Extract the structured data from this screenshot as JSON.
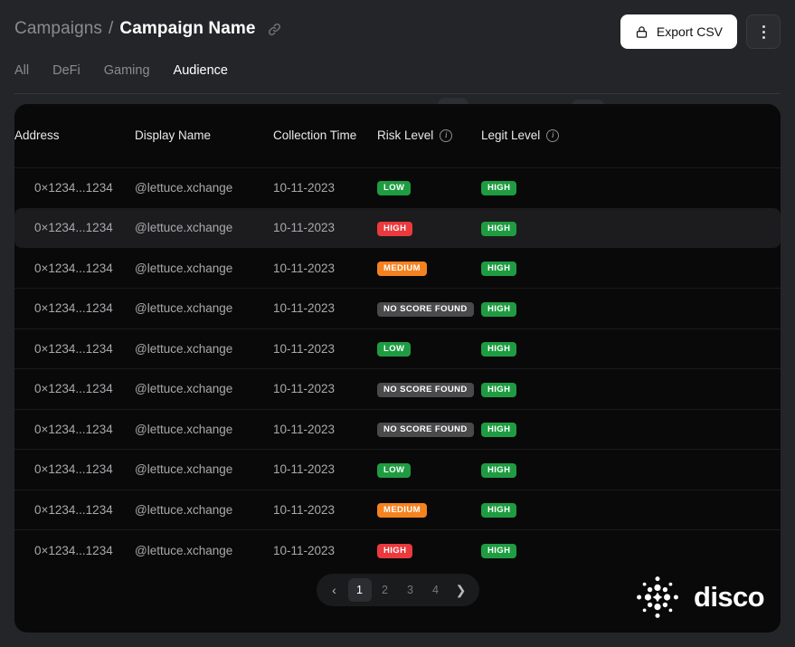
{
  "header": {
    "breadcrumb_root": "Campaigns",
    "breadcrumb_separator": "/",
    "breadcrumb_current": "Campaign Name",
    "link_icon": "chain-link-icon",
    "export_label": "Export CSV",
    "export_icon": "lock-icon",
    "menu_icon": "kebab-menu-icon"
  },
  "tabs": [
    {
      "label": "All",
      "active": false
    },
    {
      "label": "DeFi",
      "active": false
    },
    {
      "label": "Gaming",
      "active": false
    },
    {
      "label": "Audience",
      "active": true
    }
  ],
  "table": {
    "columns": [
      {
        "label": "Address",
        "info": false
      },
      {
        "label": "Display Name",
        "info": false
      },
      {
        "label": "Collection Time",
        "info": false
      },
      {
        "label": "Risk Level",
        "info": true
      },
      {
        "label": "Legit Level",
        "info": true
      }
    ],
    "rows": [
      {
        "address": "0×1234...1234",
        "display_name": "@lettuce.xchange",
        "collection_time": "10-11-2023",
        "risk": "LOW",
        "risk_variant": "low",
        "legit": "HIGH",
        "legit_variant": "legit-high",
        "hovered": false
      },
      {
        "address": "0×1234...1234",
        "display_name": "@lettuce.xchange",
        "collection_time": "10-11-2023",
        "risk": "HIGH",
        "risk_variant": "high",
        "legit": "HIGH",
        "legit_variant": "legit-high",
        "hovered": true
      },
      {
        "address": "0×1234...1234",
        "display_name": "@lettuce.xchange",
        "collection_time": "10-11-2023",
        "risk": "MEDIUM",
        "risk_variant": "medium",
        "legit": "HIGH",
        "legit_variant": "legit-high",
        "hovered": false
      },
      {
        "address": "0×1234...1234",
        "display_name": "@lettuce.xchange",
        "collection_time": "10-11-2023",
        "risk": "NO SCORE FOUND",
        "risk_variant": "none",
        "legit": "HIGH",
        "legit_variant": "legit-high",
        "hovered": false
      },
      {
        "address": "0×1234...1234",
        "display_name": "@lettuce.xchange",
        "collection_time": "10-11-2023",
        "risk": "LOW",
        "risk_variant": "low",
        "legit": "HIGH",
        "legit_variant": "legit-high",
        "hovered": false
      },
      {
        "address": "0×1234...1234",
        "display_name": "@lettuce.xchange",
        "collection_time": "10-11-2023",
        "risk": "NO SCORE FOUND",
        "risk_variant": "none",
        "legit": "HIGH",
        "legit_variant": "legit-high",
        "hovered": false
      },
      {
        "address": "0×1234...1234",
        "display_name": "@lettuce.xchange",
        "collection_time": "10-11-2023",
        "risk": "NO SCORE FOUND",
        "risk_variant": "none",
        "legit": "HIGH",
        "legit_variant": "legit-high",
        "hovered": false
      },
      {
        "address": "0×1234...1234",
        "display_name": "@lettuce.xchange",
        "collection_time": "10-11-2023",
        "risk": "LOW",
        "risk_variant": "low",
        "legit": "HIGH",
        "legit_variant": "legit-high",
        "hovered": false
      },
      {
        "address": "0×1234...1234",
        "display_name": "@lettuce.xchange",
        "collection_time": "10-11-2023",
        "risk": "MEDIUM",
        "risk_variant": "medium",
        "legit": "HIGH",
        "legit_variant": "legit-high",
        "hovered": false
      },
      {
        "address": "0×1234...1234",
        "display_name": "@lettuce.xchange",
        "collection_time": "10-11-2023",
        "risk": "HIGH",
        "risk_variant": "high",
        "legit": "HIGH",
        "legit_variant": "legit-high",
        "hovered": false
      }
    ]
  },
  "pagination": {
    "prev_icon": "chevron-left-icon",
    "next_icon": "chevron-right-icon",
    "pages": [
      "1",
      "2",
      "3",
      "4"
    ],
    "current_page": "1"
  },
  "branding": {
    "wordmark": "disco",
    "mark_icon": "disco-dot-mandala-icon"
  },
  "colors": {
    "page_background": "#242529",
    "card_background": "#090909",
    "row_hover": "#1c1c1e",
    "accent_low": "#1f9c42",
    "accent_high": "#ea3a3d",
    "accent_medium": "#f58220",
    "accent_none": "#4a4a4d",
    "export_button": "#ffffff"
  }
}
